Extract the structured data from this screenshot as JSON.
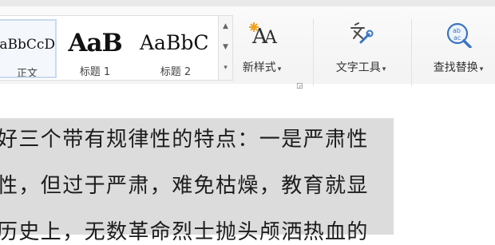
{
  "ribbon": {
    "styles": [
      {
        "sample": "aBbCcD",
        "label": "正文",
        "selected": true
      },
      {
        "sample": "AaB",
        "label": "标题 1"
      },
      {
        "sample": "AaBbC",
        "label": "标题 2"
      }
    ],
    "gallery_scroll": {
      "up": "▲",
      "down": "▼",
      "more": "▾"
    },
    "new_style": {
      "label": "新样式",
      "caret": "▾",
      "icon": "new-style-icon"
    },
    "launcher_glyph": "◲",
    "text_tools": {
      "label": "文字工具",
      "caret": "▾",
      "icon": "text-tools-icon"
    },
    "find_replace": {
      "label": "查找替换",
      "caret": "▾",
      "icon": "find-replace-icon"
    }
  },
  "document": {
    "lines": [
      "好三个带有规律性的特点：一是严肃性",
      "性，但过于严肃，难免枯燥，教育就显",
      "历史上，无数革命烈士抛头颅洒热血的"
    ]
  },
  "colors": {
    "selection_highlight": "#dcdcdc",
    "selected_style_border": "#cad9ef",
    "icon_blue": "#3a74c4",
    "sparkle": "#f2a21c"
  }
}
